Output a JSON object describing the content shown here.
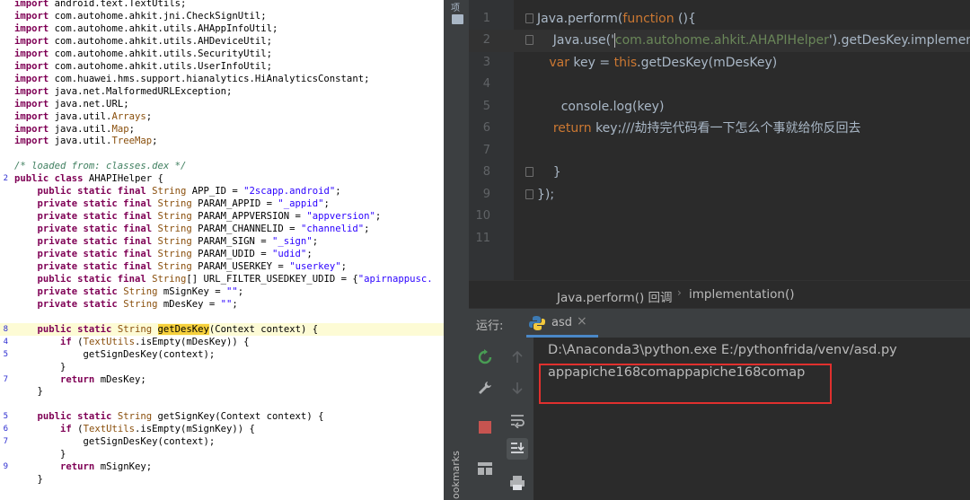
{
  "left_code": {
    "lines": [
      {
        "ln": "",
        "parts": [
          [
            "kw",
            "import"
          ],
          [
            "",
            " android.text.TextUtils;"
          ]
        ]
      },
      {
        "ln": "",
        "parts": [
          [
            "kw",
            "import"
          ],
          [
            "",
            " com.autohome.ahkit.jni.CheckSignUtil;"
          ]
        ]
      },
      {
        "ln": "",
        "parts": [
          [
            "kw",
            "import"
          ],
          [
            "",
            " com.autohome.ahkit.utils.AHAppInfoUtil;"
          ]
        ]
      },
      {
        "ln": "",
        "parts": [
          [
            "kw",
            "import"
          ],
          [
            "",
            " com.autohome.ahkit.utils.AHDeviceUtil;"
          ]
        ]
      },
      {
        "ln": "",
        "parts": [
          [
            "kw",
            "import"
          ],
          [
            "",
            " com.autohome.ahkit.utils.SecurityUtil;"
          ]
        ]
      },
      {
        "ln": "",
        "parts": [
          [
            "kw",
            "import"
          ],
          [
            "",
            " com.autohome.ahkit.utils.UserInfoUtil;"
          ]
        ]
      },
      {
        "ln": "",
        "parts": [
          [
            "kw",
            "import"
          ],
          [
            "",
            " com.huawei.hms.support.hianalytics.HiAnalyticsConstant;"
          ]
        ]
      },
      {
        "ln": "",
        "parts": [
          [
            "kw",
            "import"
          ],
          [
            "",
            " java.net.MalformedURLException;"
          ]
        ]
      },
      {
        "ln": "",
        "parts": [
          [
            "kw",
            "import"
          ],
          [
            "",
            " java.net.URL;"
          ]
        ]
      },
      {
        "ln": "",
        "parts": [
          [
            "kw",
            "import"
          ],
          [
            "",
            " java.util."
          ],
          [
            "ty",
            "Arrays"
          ],
          [
            "",
            ";"
          ]
        ]
      },
      {
        "ln": "",
        "parts": [
          [
            "kw",
            "import"
          ],
          [
            "",
            " java.util."
          ],
          [
            "ty",
            "Map"
          ],
          [
            "",
            ";"
          ]
        ]
      },
      {
        "ln": "",
        "parts": [
          [
            "kw",
            "import"
          ],
          [
            "",
            " java.util."
          ],
          [
            "ty",
            "TreeMap"
          ],
          [
            "",
            ";"
          ]
        ]
      },
      {
        "ln": "",
        "parts": [
          [
            "",
            ""
          ]
        ]
      },
      {
        "ln": "",
        "parts": [
          [
            "cm",
            "/* loaded from: classes.dex */"
          ]
        ]
      },
      {
        "ln": "2",
        "parts": [
          [
            "kw",
            "public class"
          ],
          [
            "",
            " AHAPIHelper {"
          ]
        ]
      },
      {
        "ln": "",
        "parts": [
          [
            "",
            "    "
          ],
          [
            "kw",
            "public static final"
          ],
          [
            "",
            " "
          ],
          [
            "ty",
            "String"
          ],
          [
            "",
            " APP_ID = "
          ],
          [
            "str",
            "\"2scapp.android\""
          ],
          [
            "",
            ";"
          ]
        ]
      },
      {
        "ln": "",
        "parts": [
          [
            "",
            "    "
          ],
          [
            "kw",
            "private static final"
          ],
          [
            "",
            " "
          ],
          [
            "ty",
            "String"
          ],
          [
            "",
            " PARAM_APPID = "
          ],
          [
            "str",
            "\"_appid\""
          ],
          [
            "",
            ";"
          ]
        ]
      },
      {
        "ln": "",
        "parts": [
          [
            "",
            "    "
          ],
          [
            "kw",
            "private static final"
          ],
          [
            "",
            " "
          ],
          [
            "ty",
            "String"
          ],
          [
            "",
            " PARAM_APPVERSION = "
          ],
          [
            "str",
            "\"appversion\""
          ],
          [
            "",
            ";"
          ]
        ]
      },
      {
        "ln": "",
        "parts": [
          [
            "",
            "    "
          ],
          [
            "kw",
            "private static final"
          ],
          [
            "",
            " "
          ],
          [
            "ty",
            "String"
          ],
          [
            "",
            " PARAM_CHANNELID = "
          ],
          [
            "str",
            "\"channelid\""
          ],
          [
            "",
            ";"
          ]
        ]
      },
      {
        "ln": "",
        "parts": [
          [
            "",
            "    "
          ],
          [
            "kw",
            "private static final"
          ],
          [
            "",
            " "
          ],
          [
            "ty",
            "String"
          ],
          [
            "",
            " PARAM_SIGN = "
          ],
          [
            "str",
            "\"_sign\""
          ],
          [
            "",
            ";"
          ]
        ]
      },
      {
        "ln": "",
        "parts": [
          [
            "",
            "    "
          ],
          [
            "kw",
            "private static final"
          ],
          [
            "",
            " "
          ],
          [
            "ty",
            "String"
          ],
          [
            "",
            " PARAM_UDID = "
          ],
          [
            "str",
            "\"udid\""
          ],
          [
            "",
            ";"
          ]
        ]
      },
      {
        "ln": "",
        "parts": [
          [
            "",
            "    "
          ],
          [
            "kw",
            "private static final"
          ],
          [
            "",
            " "
          ],
          [
            "ty",
            "String"
          ],
          [
            "",
            " PARAM_USERKEY = "
          ],
          [
            "str",
            "\"userkey\""
          ],
          [
            "",
            ";"
          ]
        ]
      },
      {
        "ln": "",
        "parts": [
          [
            "",
            "    "
          ],
          [
            "kw",
            "public static final"
          ],
          [
            "",
            " "
          ],
          [
            "ty",
            "String"
          ],
          [
            "",
            "[] URL_FILTER_USEDKEY_UDID = {"
          ],
          [
            "str",
            "\"apirnappusc."
          ]
        ]
      },
      {
        "ln": "",
        "parts": [
          [
            "",
            "    "
          ],
          [
            "kw",
            "private static"
          ],
          [
            "",
            " "
          ],
          [
            "ty",
            "String"
          ],
          [
            "",
            " mSignKey = "
          ],
          [
            "str",
            "\"\""
          ],
          [
            "",
            ";"
          ]
        ]
      },
      {
        "ln": "",
        "parts": [
          [
            "",
            "    "
          ],
          [
            "kw",
            "private static"
          ],
          [
            "",
            " "
          ],
          [
            "ty",
            "String"
          ],
          [
            "",
            " mDesKey = "
          ],
          [
            "str",
            "\"\""
          ],
          [
            "",
            ";"
          ]
        ]
      },
      {
        "ln": "",
        "parts": [
          [
            "",
            ""
          ]
        ]
      },
      {
        "ln": "8",
        "hl": true,
        "parts": [
          [
            "",
            "    "
          ],
          [
            "kw",
            "public static"
          ],
          [
            "",
            " "
          ],
          [
            "ty",
            "String"
          ],
          [
            "",
            " "
          ],
          [
            "mark",
            "getDesKey"
          ],
          [
            "",
            "(Context context) {"
          ]
        ]
      },
      {
        "ln": "4",
        "parts": [
          [
            "",
            "        "
          ],
          [
            "kw",
            "if"
          ],
          [
            "",
            " ("
          ],
          [
            "ty",
            "TextUtils"
          ],
          [
            "",
            ".isEmpty(mDesKey)) {"
          ]
        ]
      },
      {
        "ln": "5",
        "parts": [
          [
            "",
            "            getSignDesKey(context);"
          ]
        ]
      },
      {
        "ln": "",
        "parts": [
          [
            "",
            "        }"
          ]
        ]
      },
      {
        "ln": "7",
        "parts": [
          [
            "",
            "        "
          ],
          [
            "kw",
            "return"
          ],
          [
            "",
            " mDesKey;"
          ]
        ]
      },
      {
        "ln": "",
        "parts": [
          [
            "",
            "    }"
          ]
        ]
      },
      {
        "ln": "",
        "parts": [
          [
            "",
            ""
          ]
        ]
      },
      {
        "ln": "5",
        "parts": [
          [
            "",
            "    "
          ],
          [
            "kw",
            "public static"
          ],
          [
            "",
            " "
          ],
          [
            "ty",
            "String"
          ],
          [
            "",
            " getSignKey(Context context) {"
          ]
        ]
      },
      {
        "ln": "6",
        "parts": [
          [
            "",
            "        "
          ],
          [
            "kw",
            "if"
          ],
          [
            "",
            " ("
          ],
          [
            "ty",
            "TextUtils"
          ],
          [
            "",
            ".isEmpty(mSignKey)) {"
          ]
        ]
      },
      {
        "ln": "7",
        "parts": [
          [
            "",
            "            getSignDesKey(context);"
          ]
        ]
      },
      {
        "ln": "",
        "parts": [
          [
            "",
            "        }"
          ]
        ]
      },
      {
        "ln": "9",
        "parts": [
          [
            "",
            "        "
          ],
          [
            "kw",
            "return"
          ],
          [
            "",
            " mSignKey;"
          ]
        ]
      },
      {
        "ln": "",
        "parts": [
          [
            "",
            "    }"
          ]
        ]
      }
    ]
  },
  "editor": {
    "lines": [
      {
        "ln": "1",
        "fold": true,
        "parts": [
          [
            "fn",
            "Java.perform("
          ],
          [
            "kw",
            "function"
          ],
          [
            "fn",
            " (){"
          ]
        ]
      },
      {
        "ln": "2",
        "fold": true,
        "cursor": true,
        "parts": [
          [
            "fn",
            "    Java.use('"
          ],
          [
            "cursor",
            ""
          ],
          [
            "str",
            "com.autohome.ahkit.AHAPIHelper"
          ],
          [
            "fn",
            "').getDesKey.implemen"
          ]
        ]
      },
      {
        "ln": "3",
        "parts": [
          [
            "fn",
            "   "
          ],
          [
            "kw",
            "var"
          ],
          [
            "fn",
            " key = "
          ],
          [
            "kw",
            "this"
          ],
          [
            "fn",
            ".getDesKey(mDesKey)"
          ]
        ]
      },
      {
        "ln": "4",
        "parts": [
          [
            "fn",
            ""
          ]
        ]
      },
      {
        "ln": "5",
        "parts": [
          [
            "fn",
            "      console.log(key)"
          ]
        ]
      },
      {
        "ln": "6",
        "parts": [
          [
            "fn",
            "    "
          ],
          [
            "kw",
            "return"
          ],
          [
            "fn",
            " key;///劫持完代码看一下怎么个事就给你反回去"
          ]
        ]
      },
      {
        "ln": "7",
        "parts": [
          [
            "fn",
            ""
          ]
        ]
      },
      {
        "ln": "8",
        "fold": true,
        "parts": [
          [
            "fn",
            "    }"
          ]
        ]
      },
      {
        "ln": "9",
        "fold": true,
        "parts": [
          [
            "fn",
            "});"
          ]
        ]
      },
      {
        "ln": "10",
        "parts": [
          [
            "fn",
            ""
          ]
        ]
      },
      {
        "ln": "11",
        "parts": [
          [
            "fn",
            ""
          ]
        ]
      }
    ]
  },
  "breadcrumb": {
    "item1": "Java.perform() 回调",
    "item2": "implementation()"
  },
  "side_strip": {
    "project_label": "项",
    "bookmarks_label": "ookmarks"
  },
  "run_panel": {
    "label": "运行:",
    "tab_name": "asd",
    "tab_close": "×",
    "console_line1": "D:\\Anaconda3\\python.exe E:/pythonfrida/venv/asd.py",
    "console_line2": "appapiche168comappapiche168comap"
  },
  "colors": {
    "highlight_box": "#e0302e",
    "run_green": "#499c54",
    "stop_red": "#c75450",
    "tab_underline": "#4a88c7"
  }
}
